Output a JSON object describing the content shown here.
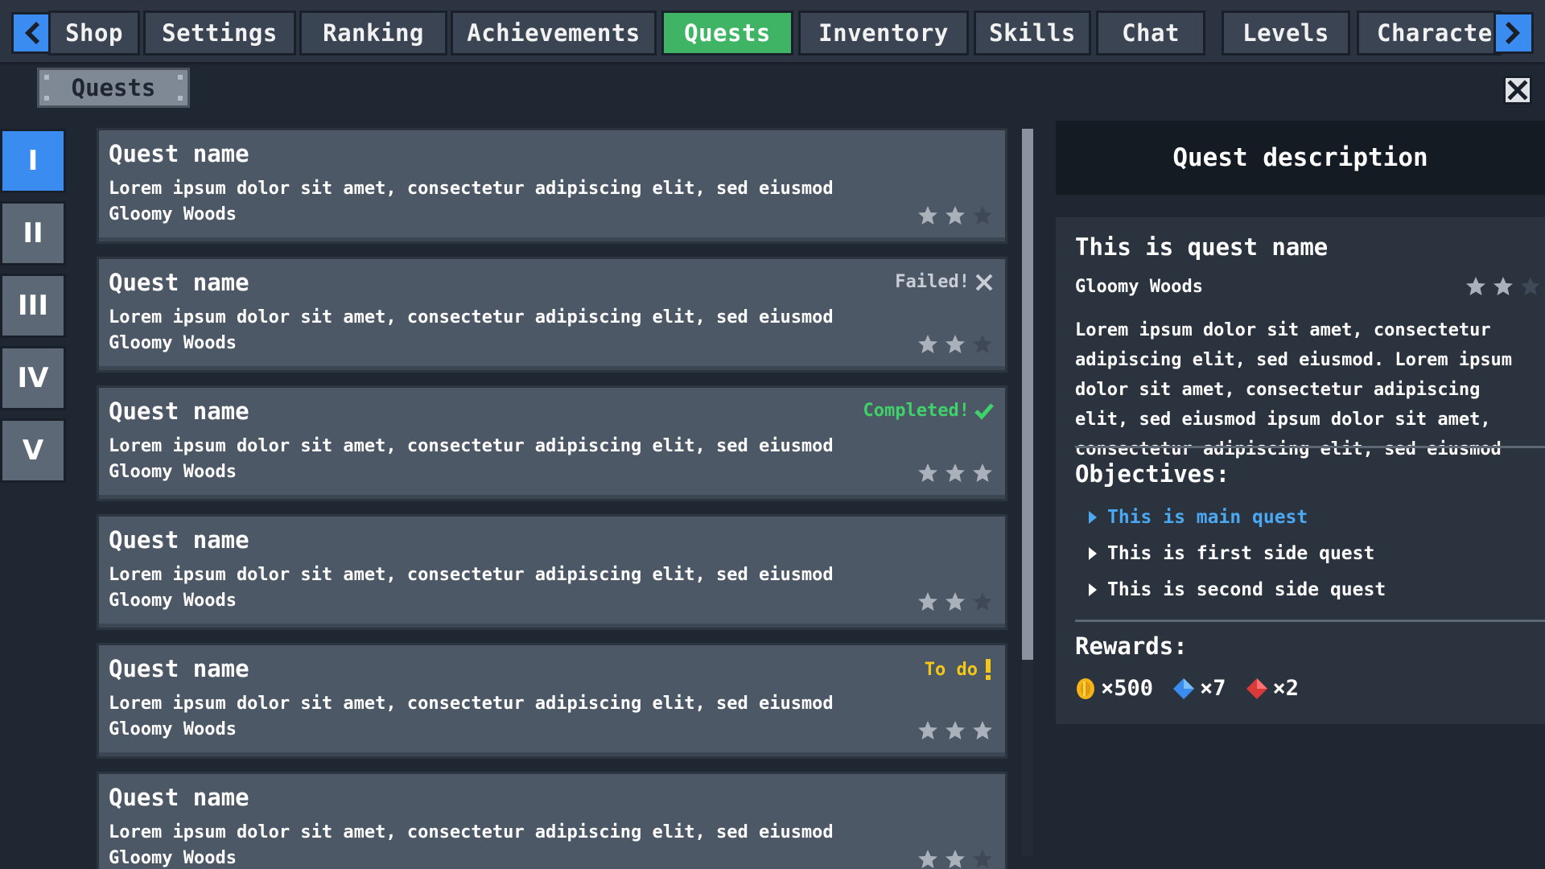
{
  "nav": {
    "tabs": [
      {
        "label": "Shop",
        "active": false
      },
      {
        "label": "Settings",
        "active": false
      },
      {
        "label": "Ranking",
        "active": false
      },
      {
        "label": "Achievements",
        "active": false
      },
      {
        "label": "Quests",
        "active": true
      },
      {
        "label": "Inventory",
        "active": false
      },
      {
        "label": "Skills",
        "active": false
      },
      {
        "label": "Chat",
        "active": false
      },
      {
        "label": "Levels",
        "active": false
      },
      {
        "label": "Character",
        "active": false
      }
    ]
  },
  "panel": {
    "label": "Quests"
  },
  "chapters": [
    "I",
    "II",
    "III",
    "IV",
    "V"
  ],
  "quests": [
    {
      "name": "Quest name",
      "desc": "Lorem ipsum dolor sit amet, consectetur adipiscing elit, sed eiusmod",
      "location": "Gloomy Woods",
      "status": "",
      "stars": 2
    },
    {
      "name": "Quest name",
      "desc": "Lorem ipsum dolor sit amet, consectetur adipiscing elit, sed eiusmod",
      "location": "Gloomy Woods",
      "status": "Failed!",
      "stars": 2
    },
    {
      "name": "Quest name",
      "desc": "Lorem ipsum dolor sit amet, consectetur adipiscing elit, sed eiusmod",
      "location": "Gloomy Woods",
      "status": "Completed!",
      "stars": 3
    },
    {
      "name": "Quest name",
      "desc": "Lorem ipsum dolor sit amet, consectetur adipiscing elit, sed eiusmod",
      "location": "Gloomy Woods",
      "status": "",
      "stars": 2
    },
    {
      "name": "Quest name",
      "desc": "Lorem ipsum dolor sit amet, consectetur adipiscing elit, sed eiusmod",
      "location": "Gloomy Woods",
      "status": "To do",
      "stars": 3
    },
    {
      "name": "Quest name",
      "desc": "Lorem ipsum dolor sit amet, consectetur adipiscing elit, sed eiusmod",
      "location": "Gloomy Woods",
      "status": "",
      "stars": 2
    }
  ],
  "detail": {
    "header": "Quest description",
    "title": "This is quest name",
    "location": "Gloomy Woods",
    "stars": 2,
    "description": "Lorem ipsum dolor sit amet, consectetur adipiscing elit, sed eiusmod. Lorem ipsum dolor sit amet, consectetur adipiscing elit, sed eiusmod ipsum dolor sit amet, consectetur adipiscing elit, sed eiusmod",
    "objectives_title": "Objectives:",
    "objectives": [
      "This is main quest",
      "This is first side quest",
      "This is second side quest"
    ],
    "rewards_title": "Rewards:",
    "rewards": [
      {
        "icon": "coin-icon",
        "amount": "×500"
      },
      {
        "icon": "blue-gem-icon",
        "amount": "×7"
      },
      {
        "icon": "red-gem-icon",
        "amount": "×2"
      }
    ]
  },
  "colors": {
    "accent_blue": "#3a8cf0",
    "active_tab": "#3fb464",
    "completed": "#3fd26a",
    "todo": "#f2c718",
    "failed": "#c9ced6"
  }
}
